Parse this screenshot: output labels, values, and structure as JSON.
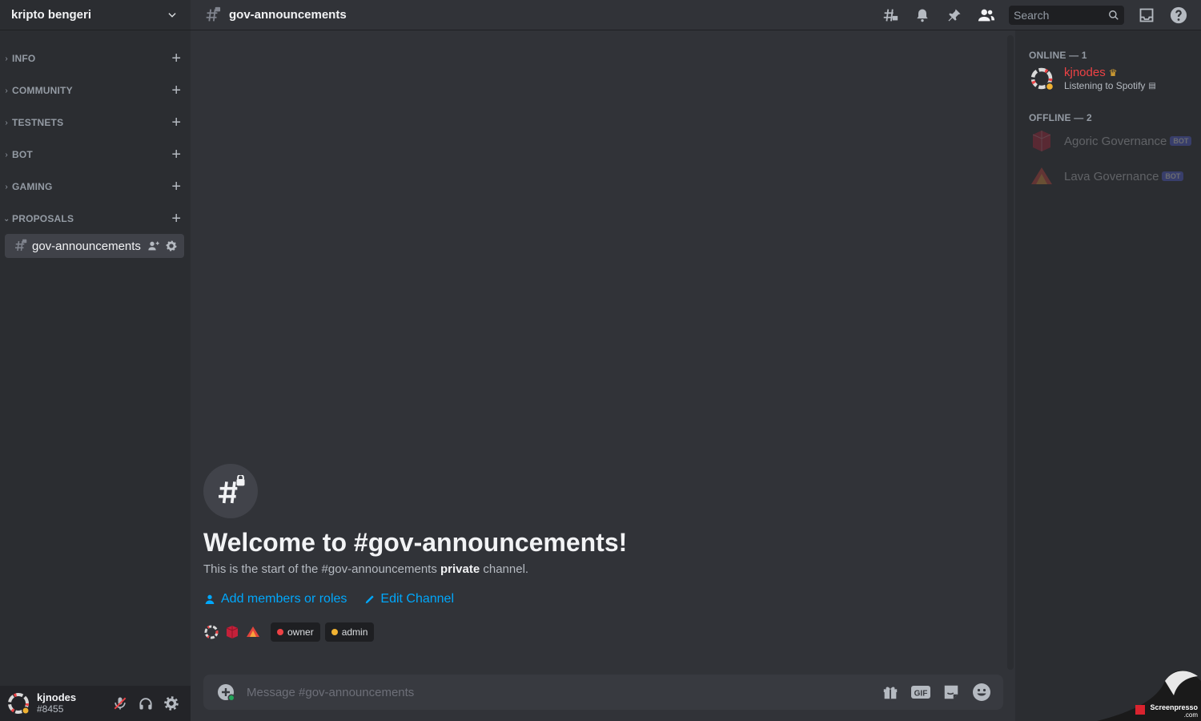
{
  "server": {
    "name": "kripto bengeri"
  },
  "categories": [
    {
      "label": "INFO",
      "expanded": false
    },
    {
      "label": "COMMUNITY",
      "expanded": false
    },
    {
      "label": "TESTNETS",
      "expanded": false
    },
    {
      "label": "BOT",
      "expanded": false
    },
    {
      "label": "GAMING",
      "expanded": false
    },
    {
      "label": "PROPOSALS",
      "expanded": true
    }
  ],
  "active_channel": {
    "name": "gov-announcements"
  },
  "header": {
    "channel": "gov-announcements",
    "search_placeholder": "Search"
  },
  "welcome": {
    "title": "Welcome to #gov-announcements!",
    "sub_prefix": "This is the start of the #gov-announcements ",
    "sub_bold": "private",
    "sub_suffix": " channel.",
    "add_members": "Add members or roles",
    "edit_channel": "Edit Channel",
    "roles": [
      {
        "name": "owner",
        "color": "#ed4245"
      },
      {
        "name": "admin",
        "color": "#f0b232"
      }
    ]
  },
  "composer": {
    "placeholder": "Message #gov-announcements"
  },
  "user": {
    "name": "kjnodes",
    "tag": "#8455"
  },
  "members": {
    "online_label": "ONLINE — 1",
    "offline_label": "OFFLINE — 2",
    "online": [
      {
        "name": "kjnodes",
        "activity": "Listening to Spotify",
        "color": "#ed4245"
      }
    ],
    "offline": [
      {
        "name": "Agoric Governance",
        "badge": "BOT"
      },
      {
        "name": "Lava Governance",
        "badge": "BOT"
      }
    ]
  },
  "watermark": {
    "text": "Screenpresso",
    "sub": ".com"
  }
}
